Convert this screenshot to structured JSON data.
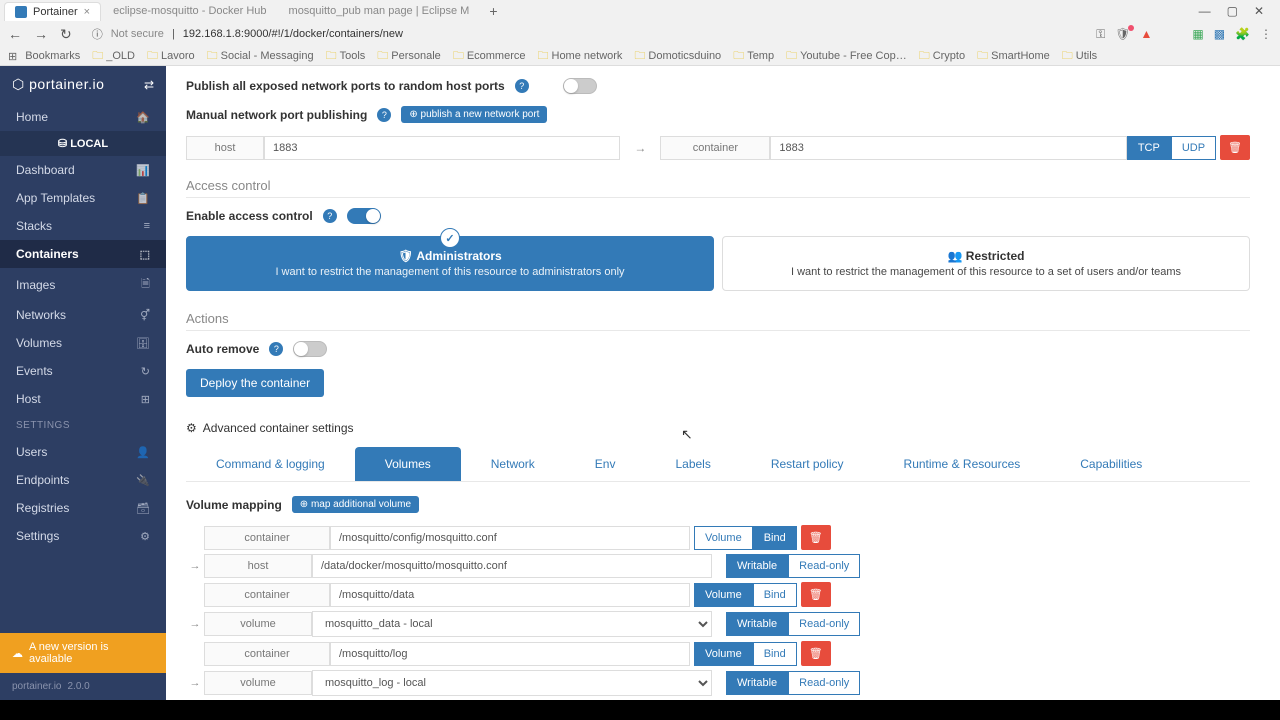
{
  "browser": {
    "tabs": [
      {
        "title": "Portainer",
        "active": true
      },
      {
        "title": "eclipse-mosquitto - Docker Hub",
        "active": false
      },
      {
        "title": "mosquitto_pub man page | Eclipse M",
        "active": false
      }
    ],
    "nav": {
      "back": "←",
      "forward": "→",
      "reload": "↻"
    },
    "security": "Not secure",
    "url": "192.168.1.8:9000/#!/1/docker/containers/new",
    "window": {
      "min": "—",
      "max": "▢",
      "close": "✕"
    },
    "bookmarks_label": "Bookmarks",
    "bookmarks": [
      "_OLD",
      "Lavoro",
      "Social - Messaging",
      "Tools",
      "Personale",
      "Ecommerce",
      "Home network",
      "Domoticsduino",
      "Temp",
      "Youtube - Free Cop…",
      "Crypto",
      "SmartHome",
      "Utils"
    ]
  },
  "sidebar": {
    "brand": "portainer.io",
    "home": "Home",
    "local": "⛁ LOCAL",
    "items": [
      {
        "label": "Dashboard",
        "icon": "📊"
      },
      {
        "label": "App Templates",
        "icon": "📋"
      },
      {
        "label": "Stacks",
        "icon": "≡"
      },
      {
        "label": "Containers",
        "icon": "⬚"
      },
      {
        "label": "Images",
        "icon": "🗎"
      },
      {
        "label": "Networks",
        "icon": "⚥"
      },
      {
        "label": "Volumes",
        "icon": "🗄"
      },
      {
        "label": "Events",
        "icon": "↻"
      },
      {
        "label": "Host",
        "icon": "⊞"
      }
    ],
    "active_index": 3,
    "settings_header": "SETTINGS",
    "settings": [
      {
        "label": "Users",
        "icon": "👤"
      },
      {
        "label": "Endpoints",
        "icon": "🔌"
      },
      {
        "label": "Registries",
        "icon": "🗃"
      },
      {
        "label": "Settings",
        "icon": "⚙"
      }
    ],
    "update": "A new version is available",
    "footer": {
      "brand": "portainer.io",
      "version": "2.0.0"
    }
  },
  "form": {
    "publish_label": "Publish all exposed network ports to random host ports",
    "manual_label": "Manual network port publishing",
    "publish_btn": "⊕ publish a new network port",
    "port": {
      "host_label": "host",
      "host_val": "1883",
      "container_label": "container",
      "container_val": "1883",
      "tcp": "TCP",
      "udp": "UDP"
    },
    "access_title": "Access control",
    "access_enable": "Enable access control",
    "cards": {
      "admin": {
        "title": "Administrators",
        "desc": "I want to restrict the management of this resource to administrators only"
      },
      "restricted": {
        "title": "Restricted",
        "desc": "I want to restrict the management of this resource to a set of users and/or teams"
      }
    },
    "actions_title": "Actions",
    "auto_remove": "Auto remove",
    "deploy": "Deploy the container",
    "adv_title": "Advanced container settings",
    "tabs": [
      "Command & logging",
      "Volumes",
      "Network",
      "Env",
      "Labels",
      "Restart policy",
      "Runtime & Resources",
      "Capabilities"
    ],
    "active_tab": 1,
    "volmap_label": "Volume mapping",
    "volmap_btn": "⊕ map additional volume",
    "vol": {
      "container_label": "container",
      "host_label": "host",
      "volume_label": "volume",
      "volume_btn": "Volume",
      "bind_btn": "Bind",
      "writable_btn": "Writable",
      "readonly_btn": "Read-only",
      "rows": [
        {
          "container": "/mosquitto/config/mosquitto.conf",
          "type": "bind",
          "src_label": "host",
          "src": "/data/docker/mosquitto/mosquitto.conf",
          "is_input": true
        },
        {
          "container": "/mosquitto/data",
          "type": "volume",
          "src_label": "volume",
          "src": "mosquitto_data - local",
          "is_input": false
        },
        {
          "container": "/mosquitto/log",
          "type": "volume",
          "src_label": "volume",
          "src": "mosquitto_log - local",
          "is_input": false
        }
      ]
    }
  }
}
